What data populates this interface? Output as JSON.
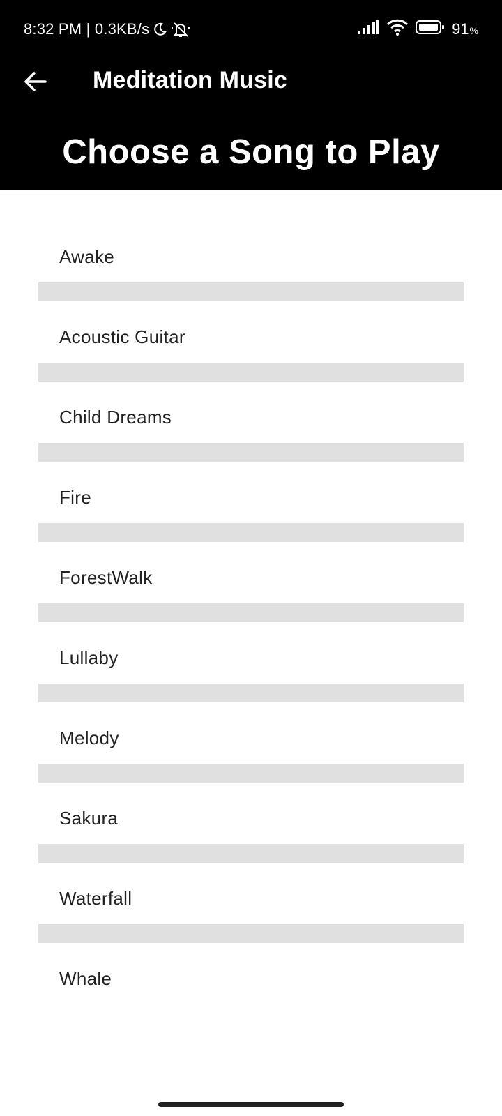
{
  "status_bar": {
    "time_and_speed": "8:32 PM | 0.3KB/s",
    "battery_level": "91",
    "battery_percent_sign": "%",
    "icons": [
      "moon-icon",
      "mute-icon",
      "signal-icon",
      "wifi-icon",
      "battery-icon"
    ]
  },
  "toolbar": {
    "title": "Meditation Music",
    "back_icon": "arrow-left-icon"
  },
  "banner": {
    "title": "Choose a Song to Play"
  },
  "songs": [
    "Awake",
    "Acoustic Guitar",
    "Child Dreams",
    "Fire",
    "ForestWalk",
    "Lullaby",
    "Melody",
    "Sakura",
    "Waterfall",
    "Whale"
  ],
  "colors": {
    "header_bg": "#000000",
    "header_text": "#ffffff",
    "list_divider": "#e0e0e0",
    "list_text": "#222222"
  }
}
